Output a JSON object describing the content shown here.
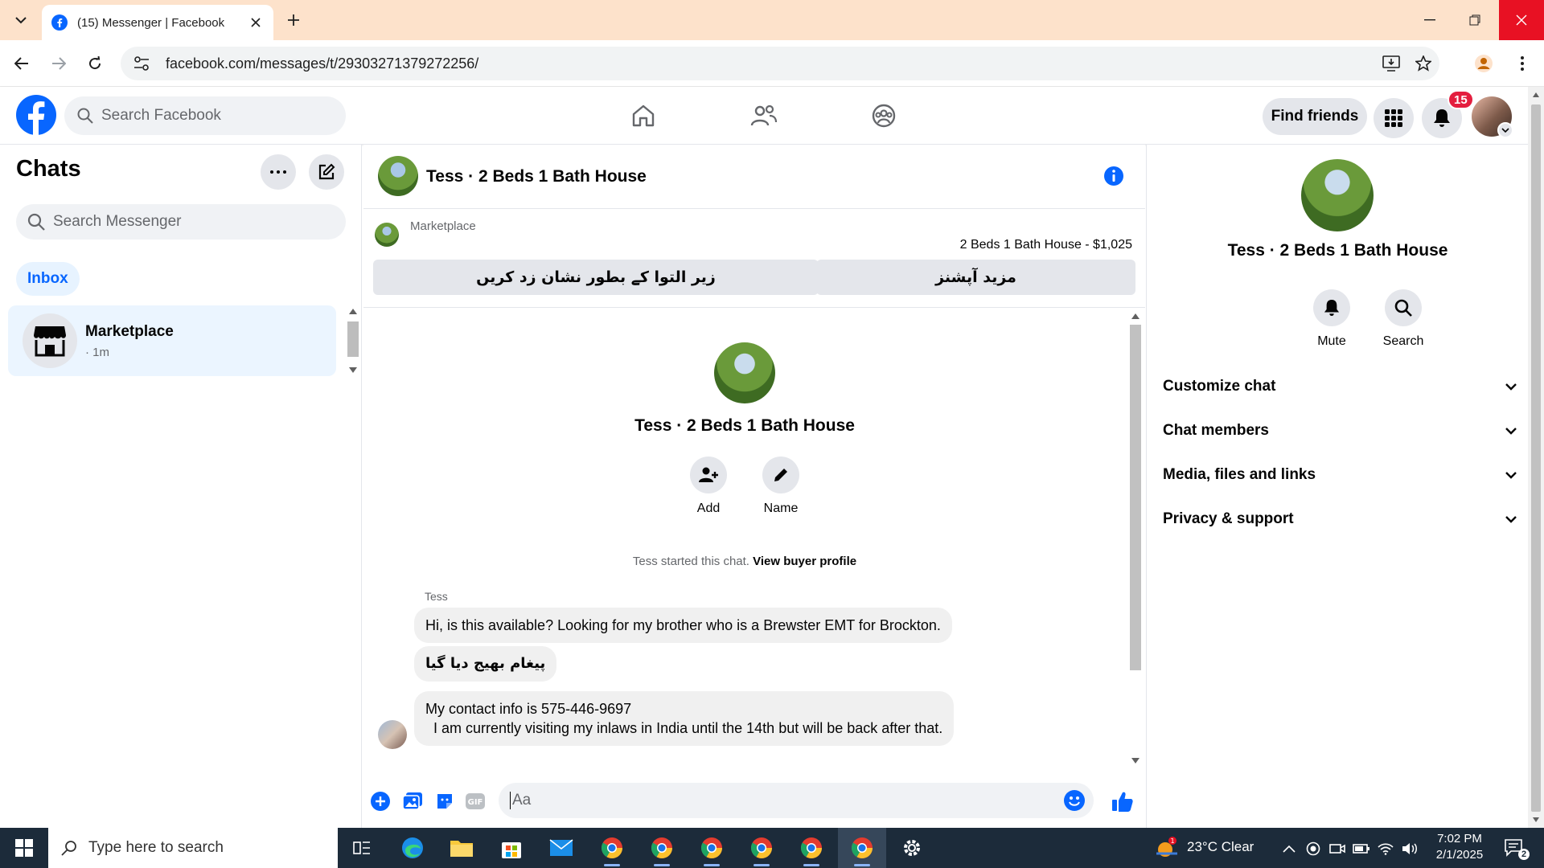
{
  "browser": {
    "tab_title": "(15) Messenger | Facebook",
    "url": "facebook.com/messages/t/29303271379272256/"
  },
  "fb_header": {
    "search_placeholder": "Search Facebook",
    "find_friends_label": "Find friends",
    "notification_count": "15"
  },
  "chats_panel": {
    "title": "Chats",
    "search_placeholder": "Search Messenger",
    "filter_label": "Inbox",
    "items": [
      {
        "name": "Marketplace",
        "time": "· 1m"
      }
    ]
  },
  "conversation": {
    "title": "Tess · 2 Beds 1 Bath House",
    "marketplace_label": "Marketplace",
    "listing": "2 Beds 1 Bath House - $1,025",
    "buttons": {
      "mark_pending": "زیر التوا کے بطور نشان زد کریں",
      "more_options": "مزید آپشنز"
    },
    "profile_name": "Tess · 2 Beds 1 Bath House",
    "actions": {
      "add": "Add",
      "name": "Name"
    },
    "started_text": "Tess started this chat.",
    "view_buyer_profile": "View buyer profile",
    "sender": "Tess",
    "messages": [
      "Hi, is this available? Looking for my brother who is a Brewster EMT for Brockton.",
      "پیغام بھیج دیا گیا",
      "My contact info is 575-446-9697",
      "  I am currently visiting my inlaws in India until the 14th but will be back after that."
    ],
    "composer_placeholder": "Aa"
  },
  "info_panel": {
    "name": "Tess · 2 Beds 1 Bath House",
    "mute_label": "Mute",
    "search_label": "Search",
    "sections": [
      "Customize chat",
      "Chat members",
      "Media, files and links",
      "Privacy & support"
    ]
  },
  "taskbar": {
    "search_placeholder": "Type here to search",
    "weather": "23°C  Clear",
    "time": "7:02 PM",
    "date": "2/1/2025",
    "notification_count": "2"
  },
  "colors": {
    "fb_blue": "#0866ff",
    "tab_strip": "#fde2cb",
    "taskbar": "#1c2b3a"
  }
}
